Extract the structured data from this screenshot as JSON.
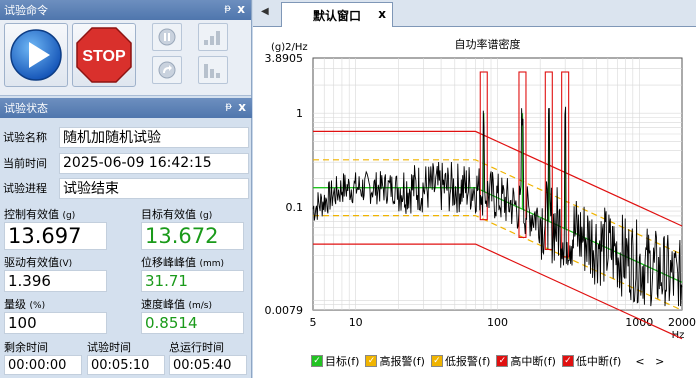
{
  "command_panel": {
    "title": "试验命令",
    "pin_icon": "ᵽ",
    "close_icon": "x",
    "play_label": "",
    "stop_label": "STOP"
  },
  "status_panel": {
    "title": "试验状态",
    "pin_icon": "ᵽ",
    "close_icon": "x",
    "test_name_label": "试验名称",
    "test_name_value": "随机加随机试验",
    "current_time_label": "当前时间",
    "current_time_value": "2025-06-09 16:42:15",
    "progress_label": "试验进程",
    "progress_value": "试验结束",
    "control_rms_label": "控制有效值",
    "control_rms_unit": "(g)",
    "control_rms_value": "13.697",
    "target_rms_label": "目标有效值",
    "target_rms_unit": "(g)",
    "target_rms_value": "13.672",
    "drive_rms_label": "驱动有效值",
    "drive_rms_unit": "(V)",
    "drive_rms_value": "1.396",
    "disp_peak_label": "位移峰峰值",
    "disp_peak_unit": "(mm)",
    "disp_peak_value": "31.71",
    "level_label": "量级",
    "level_unit": "(%)",
    "level_value": "100",
    "vel_peak_label": "速度峰值",
    "vel_peak_unit": "(m/s)",
    "vel_peak_value": "0.8514",
    "remaining_label": "剩余时间",
    "remaining_value": "00:00:00",
    "test_time_label": "试验时间",
    "test_time_value": "00:05:10",
    "total_time_label": "总运行时间",
    "total_time_value": "00:05:40"
  },
  "tab": {
    "label": "默认窗口",
    "close": "x",
    "nav": "◀"
  },
  "chart_data": {
    "type": "line",
    "title": "自功率谱密度",
    "ylabel": "(g)2/Hz",
    "xlabel": "Hz",
    "x_scale": "log",
    "y_scale": "log",
    "xlim": [
      5,
      2000
    ],
    "ylim": [
      0.0079,
      3.8905
    ],
    "x_ticks": [
      "5",
      "10",
      "100",
      "1000",
      "2000"
    ],
    "y_ticks": [
      "3.8905",
      "1",
      "0.1",
      "0.0079"
    ],
    "grid": true,
    "legend": [
      {
        "name": "目标(f)",
        "color": "#22c322"
      },
      {
        "name": "高报警(f)",
        "color": "#f0b400"
      },
      {
        "name": "低报警(f)",
        "color": "#f0b400"
      },
      {
        "name": "高中断(f)",
        "color": "#e01010"
      },
      {
        "name": "低中断(f)",
        "color": "#e01010"
      }
    ],
    "legend_scroll_left": "<",
    "legend_scroll_right": ">",
    "target_profile": {
      "x": [
        5,
        70,
        2000
      ],
      "y": [
        0.16,
        0.16,
        0.0156
      ]
    },
    "sine_peaks": [
      {
        "f": 80,
        "y": 1.0
      },
      {
        "f": 150,
        "y": 1.0
      },
      {
        "f": 230,
        "y": 1.0
      },
      {
        "f": 300,
        "y": 1.0
      }
    ],
    "alarm_offset_factor": 1.41,
    "abort_offset_factor": 2.0
  }
}
